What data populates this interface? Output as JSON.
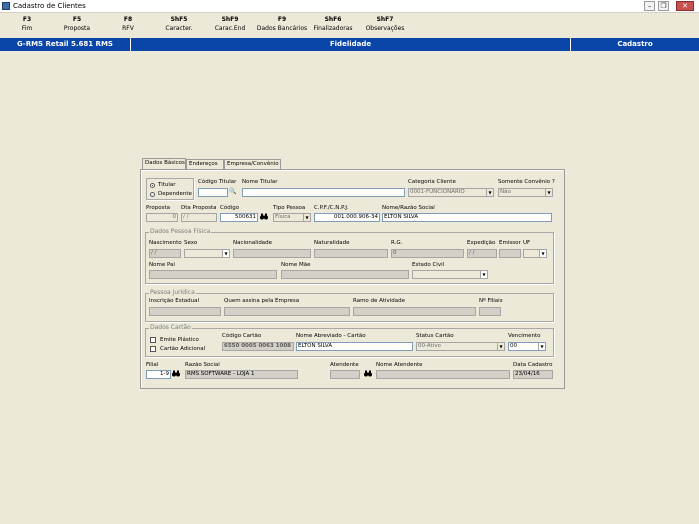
{
  "window": {
    "title": "Cadastro de Clientes"
  },
  "toolbar": [
    {
      "key": "F3",
      "label": "Fim"
    },
    {
      "key": "F5",
      "label": "Proposta"
    },
    {
      "key": "F8",
      "label": "RFV"
    },
    {
      "key": "ShF5",
      "label": "Caracter."
    },
    {
      "key": "ShF9",
      "label": "Carac.End"
    },
    {
      "key": "F9",
      "label": "Dados Bancários"
    },
    {
      "key": "ShF6",
      "label": "Finalizadoras"
    },
    {
      "key": "ShF7",
      "label": "Observações"
    }
  ],
  "status": {
    "left": "G-RMS Retail 5.681 RMS",
    "center": "Fidelidade",
    "right": "Cadastro"
  },
  "tabs": [
    "Dados Básicos",
    "Endereços",
    "Empresa/Convênio"
  ],
  "top": {
    "titular": "Titular",
    "dependente": "Dependente",
    "codigo_titular_label": "Código Titular",
    "nome_titular_label": "Nome Titular",
    "categoria_label": "Categoria Cliente",
    "categoria_value": "0001-FUNCIONARIO",
    "somente_convenio_label": "Somente Convênio ?",
    "somente_convenio_value": "Não"
  },
  "row2": {
    "proposta_label": "Proposta",
    "proposta_value": "0",
    "dta_proposta_label": "Dta Proposta",
    "dta_proposta_value": "/  /",
    "codigo_label": "Código",
    "codigo_value": "500631",
    "tipo_pessoa_label": "Tipo Pessoa",
    "tipo_pessoa_value": "Física",
    "cpf_label": "C.P.F./C.N.P.J.",
    "cpf_value": "001.000.906-34",
    "nome_label": "Nome/Razão Social",
    "nome_value": "ELTON SILVA"
  },
  "pf": {
    "title": "Dados Pessoa Física",
    "nascimento_label": "Nascimento",
    "nascimento_value": "/  /",
    "sexo_label": "Sexo",
    "nacionalidade_label": "Nacionalidade",
    "naturalidade_label": "Naturalidade",
    "rg_label": "R.G.",
    "rg_value": "0",
    "expedicao_label": "Expedição",
    "expedicao_value": "/  /",
    "emissor_label": "Emissor",
    "uf_label": "UF",
    "pai_label": "Nome Pai",
    "mae_label": "Nome Mãe",
    "estado_civil_label": "Estado Civil"
  },
  "pj": {
    "title": "Pessoa Jurídica",
    "ie_label": "Inscrição Estadual",
    "quem_assina_label": "Quem assina pela Empresa",
    "ramo_label": "Ramo de Atividade",
    "filiais_label": "Nº Filiais"
  },
  "cartao": {
    "title": "Dados Cartão",
    "emite_plastico": "Emite Plástico",
    "cartao_adicional": "Cartão Adicional",
    "codigo_label": "Código Cartão",
    "codigo_value": "6550 0005 0063 1008",
    "nome_abrev_label": "Nome Abreviado - Cartão",
    "nome_abrev_value": "ELTON SILVA",
    "status_label": "Status Cartão",
    "status_value": "00-Ativo",
    "vencimento_label": "Vencimento",
    "vencimento_value": "00"
  },
  "bottom": {
    "filial_label": "Filial",
    "filial_value": "1-9",
    "razao_label": "Razão Social",
    "razao_value": "RMS SOFTWARE - LOJA 1",
    "atendente_label": "Atendente",
    "nome_atendente_label": "Nome Atendente",
    "data_cadastro_label": "Data Cadastro",
    "data_cadastro_value": "23/04/16"
  }
}
